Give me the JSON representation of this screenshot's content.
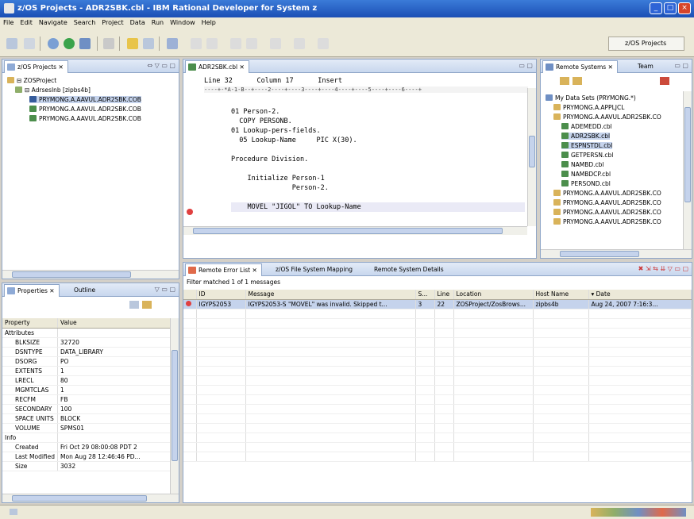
{
  "window": {
    "title": "z/OS Projects - ADR2SBK.cbl - IBM Rational Developer for System z",
    "perspective": "z/OS Projects"
  },
  "menu": [
    "File",
    "Edit",
    "Navigate",
    "Search",
    "Project",
    "Data",
    "Run",
    "Window",
    "Help"
  ],
  "projects_view": {
    "tab_label": "z/OS Projects",
    "tree": [
      {
        "label": "ZOSProject",
        "level": 0
      },
      {
        "label": "AdrsesInb [zipbs4b]",
        "level": 1
      },
      {
        "label": "PRYMONG.A.AAVUL.ADR2SBK.COB",
        "level": 2
      },
      {
        "label": "PRYMONG.A.AAVUL.ADR2SBK.COB",
        "level": 2
      },
      {
        "label": "PRYMONG.A.AAVUL.ADR2SBK.COB",
        "level": 2
      }
    ]
  },
  "editor": {
    "tab_label": "ADR2SBK.cbl",
    "status_line": "Line 32      Column 17      Insert",
    "ruler": "----+-*A-1-B--+----2----+----3----+----4----+----5----+----6----+",
    "lines": [
      "01 Person-2.",
      "  COPY PERSONB.",
      "01 Lookup-pers-fields.",
      "  05 Lookup-Name     PIC X(30).",
      "",
      "Procedure Division.",
      "",
      "    Initialize Person-1",
      "               Person-2.",
      "",
      "    MOVEL \"JIGOL\" TO Lookup-Name"
    ]
  },
  "remote_systems": {
    "tab_label": "Remote Systems",
    "tab2_label": "Team",
    "tree": [
      {
        "label": "My Data Sets (PRYMONG.*)",
        "level": 0
      },
      {
        "label": "PRYMONG.A.APPLJCL",
        "level": 1
      },
      {
        "label": "PRYMONG.A.AAVUL.ADR2SBK.CO",
        "level": 1
      },
      {
        "label": "ADEMEDD.cbl",
        "level": 2
      },
      {
        "label": "ADR2SBK.cbl",
        "level": 2
      },
      {
        "label": "ESPNSTDL.cbl",
        "level": 2
      },
      {
        "label": "GETPERSN.cbl",
        "level": 2
      },
      {
        "label": "NAMBD.cbl",
        "level": 2
      },
      {
        "label": "NAMBDCP.cbl",
        "level": 2
      },
      {
        "label": "PERSOND.cbl",
        "level": 2
      },
      {
        "label": "PRYMONG.A.AAVUL.ADR2SBK.CO",
        "level": 1
      },
      {
        "label": "PRYMONG.A.AAVUL.ADR2SBK.CO",
        "level": 1
      },
      {
        "label": "PRYMONG.A.AAVUL.ADR2SBK.CO",
        "level": 1
      },
      {
        "label": "PRYMONG.A.AAVUL.ADR2SBK.CO",
        "level": 1
      }
    ]
  },
  "properties": {
    "tab_label": "Properties",
    "tab2_label": "Outline",
    "col_property": "Property",
    "col_value": "Value",
    "rows": [
      {
        "k": "Attributes",
        "v": "",
        "group": true
      },
      {
        "k": "BLKSIZE",
        "v": "32720"
      },
      {
        "k": "DSNTYPE",
        "v": "DATA_LIBRARY"
      },
      {
        "k": "DSORG",
        "v": "PO"
      },
      {
        "k": "EXTENTS",
        "v": "1"
      },
      {
        "k": "LRECL",
        "v": "80"
      },
      {
        "k": "MGMTCLAS",
        "v": "1"
      },
      {
        "k": "RECFM",
        "v": "FB"
      },
      {
        "k": "SECONDARY",
        "v": "100"
      },
      {
        "k": "SPACE UNITS",
        "v": "BLOCK"
      },
      {
        "k": "VOLUME",
        "v": "SPMS01"
      },
      {
        "k": "Info",
        "v": "",
        "group": true
      },
      {
        "k": "Created",
        "v": "Fri Oct 29 08:00:08 PDT 2"
      },
      {
        "k": "Last Modified",
        "v": "Mon Aug 28 12:46:46 PD..."
      },
      {
        "k": "Size",
        "v": "3032"
      }
    ]
  },
  "errors": {
    "tab_label": "Remote Error List",
    "tab2_label": "z/OS File System Mapping",
    "tab3_label": "Remote System Details",
    "filter_text": "Filter matched 1 of 1 messages",
    "columns": [
      "ID",
      "Message",
      "S...",
      "Line",
      "Location",
      "Host Name",
      "Date"
    ],
    "rows": [
      {
        "id": "IGYPS2053",
        "message": "IGYPS2053-S \"MOVEL\" was invalid. Skipped t...",
        "sev": "3",
        "line": "22",
        "location": "ZOSProject/ZosBrows...",
        "host": "zipbs4b",
        "date": "Aug 24, 2007 7:16:3..."
      }
    ]
  },
  "colors": {
    "accent": "#3b7bd8",
    "panel_border": "#8fa6c8",
    "selection": "#c5d3ec"
  }
}
